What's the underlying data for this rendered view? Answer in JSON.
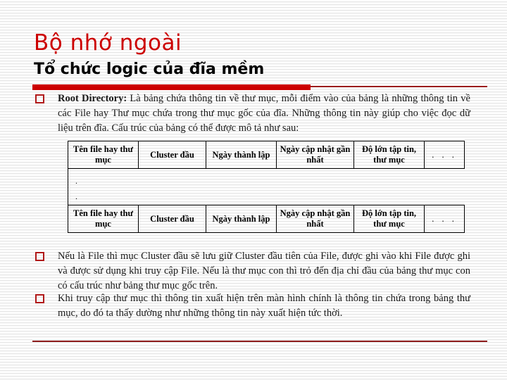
{
  "slide": {
    "title": "Bộ nhớ ngoài",
    "subtitle": "Tổ chức logic của đĩa mềm",
    "accent_color": "#CC0000",
    "rule_color": "#8C1A1A",
    "bullet_marker_color": "#B01818",
    "bullet_marker_glyph": "hollow-square"
  },
  "bullets": [
    {
      "lead": "Root Directory:",
      "text": " Là bảng chứa thông tin về thư mục, mỗi điểm vào của bảng là những thông tin về các File hay Thư mục chứa trong thư mục gốc của đĩa. Những thông tin này giúp cho việc đọc dữ liệu trên đĩa. Cấu trúc của bảng có thể được mô tả như sau:"
    },
    {
      "lead": "",
      "text": "Nếu là File thì mục Cluster đầu sẽ lưu giữ Cluster đầu tiên của File, được ghi vào khi File được ghi và được sử dụng khi truy cập File. Nếu là thư mục con thì trỏ đến địa chỉ đầu của bảng thư mục con có cấu trúc như bảng thư mục gốc trên."
    },
    {
      "lead": "",
      "text": "Khi truy cập thư mục thì thông tin xuất hiện trên màn hình chính là thông tin chứa trong bảng thư mục, do đó ta thấy dường như những thông tin này xuất hiện tức thời."
    }
  ],
  "dir_table": {
    "header_row": [
      "Tên file hay thư mục",
      "Cluster đầu",
      "Ngày thành lập",
      "Ngày cập nhật gần nhất",
      "Độ lớn tập tin, thư mục",
      ". . ."
    ],
    "spacer_marks": ".",
    "footer_row": [
      "Tên file hay thư mục",
      "Cluster đầu",
      "Ngày thành lập",
      "Ngày cập nhật gần nhất",
      "Độ lớn tập tin, thư mục",
      ". . ."
    ]
  }
}
